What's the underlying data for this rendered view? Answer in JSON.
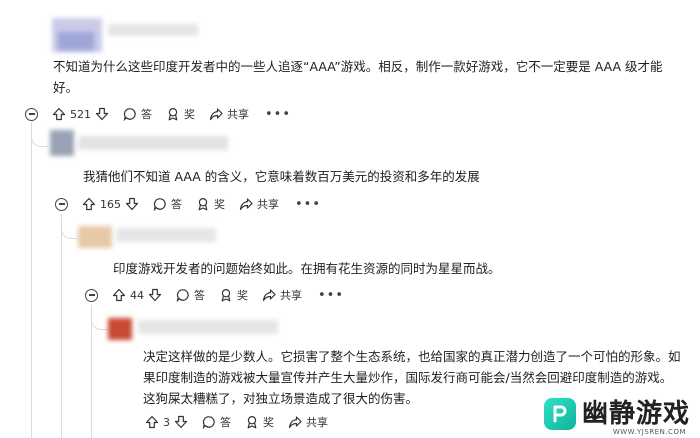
{
  "comments": [
    {
      "text": "不知道为什么这些印度开发者中的一些人追逐“AAA”游戏。相反，制作一款好游戏，它不一定要是 AAA 级才能好。",
      "votes": "521"
    },
    {
      "text": "我猜他们不知道 AAA 的含义，它意味着数百万美元的投资和多年的发展",
      "votes": "165"
    },
    {
      "text": "印度游戏开发者的问题始终如此。在拥有花生资源的同时为星星而战。",
      "votes": "44"
    },
    {
      "text": "决定这样做的是少数人。它损害了整个生态系统，也给国家的真正潜力创造了一个可怕的形象。如果印度制造的游戏被大量宣传并产生大量炒作，国际发行商可能会/当然会回避印度制造的游戏。这狗屎太糟糕了，对独立场景造成了很大的伤害。",
      "votes": "3"
    }
  ],
  "actions": {
    "reply": "答",
    "award": "奖",
    "share": "共享",
    "more": "•••"
  },
  "icons": [
    "collapse-icon",
    "upvote-icon",
    "downvote-icon",
    "comment-icon",
    "award-icon",
    "share-icon"
  ],
  "watermark": {
    "title": "幽静游戏",
    "url": "WWW.YJSREN.COM"
  },
  "colors": {
    "avatar1": "#a7acd9",
    "avatar2": "#9aa3b5",
    "avatar3": "#e7c9a8",
    "avatar4": "#c84a35",
    "watermark": "#18c4aa"
  }
}
